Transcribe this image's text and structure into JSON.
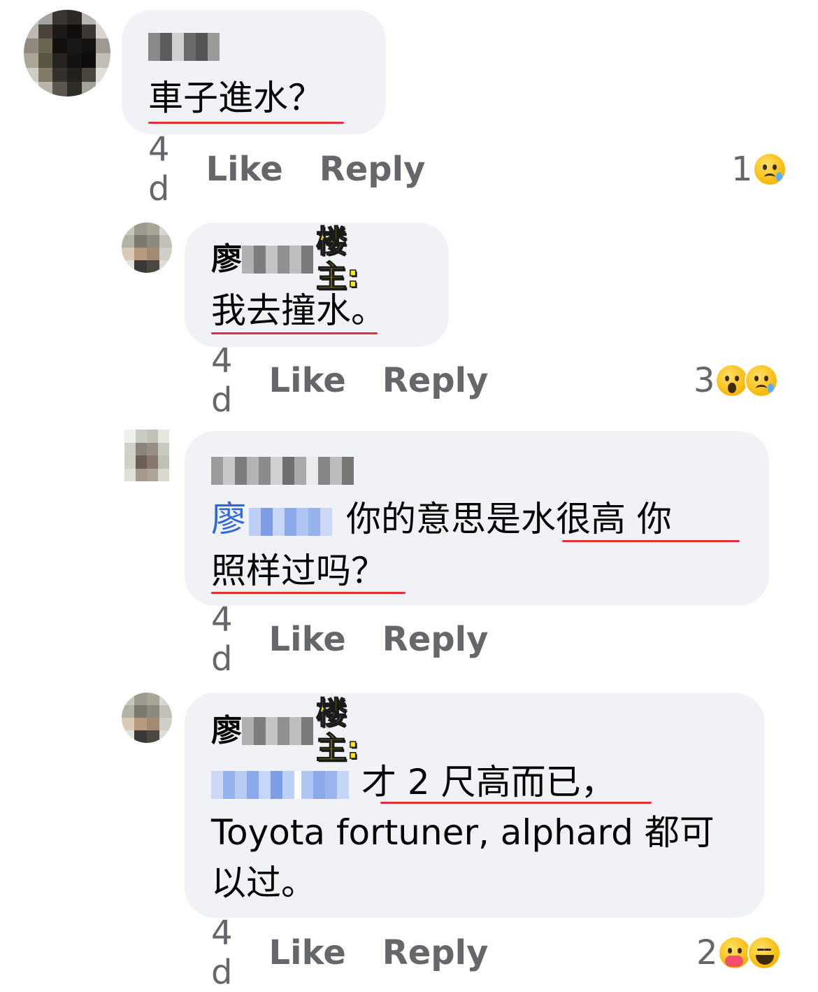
{
  "comments": [
    {
      "author_visible": "",
      "lines": [
        "車子進水？"
      ],
      "time": "4 d",
      "like_label": "Like",
      "reply_label": "Reply",
      "reaction_count": "1",
      "reactions": [
        "sad-emoji"
      ]
    },
    {
      "author_visible": "廖",
      "op_tag": "楼主:",
      "lines": [
        "我去撞水。"
      ],
      "time": "4 d",
      "like_label": "Like",
      "reply_label": "Reply",
      "reaction_count": "3",
      "reactions": [
        "wow-emoji",
        "sad-emoji"
      ]
    },
    {
      "author_visible": "",
      "mention_visible": "廖",
      "line1_text": "你的意思是水很高 你",
      "line2_text": "照样过吗？",
      "time": "4 d",
      "like_label": "Like",
      "reply_label": "Reply"
    },
    {
      "author_visible": "廖",
      "op_tag": "楼主:",
      "line1_text": "才 2 尺高而已，",
      "line2_text": "Toyota fortuner, alphard 都可",
      "line3_text": "以过。",
      "time": "4 d",
      "like_label": "Like",
      "reply_label": "Reply",
      "reaction_count": "2",
      "reactions": [
        "care-emoji",
        "haha-emoji"
      ]
    }
  ],
  "colors": {
    "bubble": "#f0f2f5",
    "meta_text": "#65676b",
    "underline": "#e0303a",
    "mention": "#2e67d8",
    "op_tag": "#ffe81a"
  }
}
